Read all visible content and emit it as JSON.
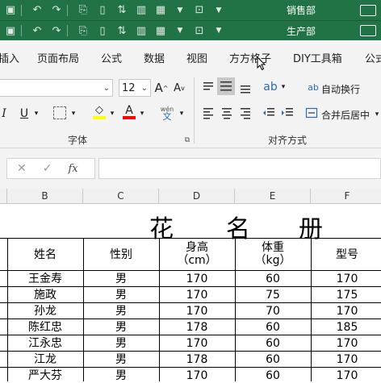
{
  "quick_access": [
    {
      "department": "销售部"
    },
    {
      "department": "生产部"
    }
  ],
  "ribbon_tabs": [
    "插入",
    "页面布局",
    "公式",
    "数据",
    "视图",
    "方方格子",
    "DIY工具箱",
    "公式"
  ],
  "font_group": {
    "label": "字体",
    "font_name": "",
    "font_size": "12",
    "underline": "U"
  },
  "align_group": {
    "label": "对齐方式",
    "wrap_text": "自动换行",
    "merge_center": "合并后居中"
  },
  "formula_bar": {
    "fx_label": "fx",
    "content": ""
  },
  "columns": [
    "B",
    "C",
    "D",
    "E",
    "F"
  ],
  "sheet_title": [
    "花",
    "名",
    "册"
  ],
  "table": {
    "headers": [
      {
        "line1": "姓名",
        "line2": ""
      },
      {
        "line1": "性别",
        "line2": ""
      },
      {
        "line1": "身高",
        "line2": "（cm）"
      },
      {
        "line1": "体重",
        "line2": "（kg）"
      },
      {
        "line1": "型号",
        "line2": ""
      }
    ],
    "rows": [
      [
        "王金寿",
        "男",
        "170",
        "60",
        "170"
      ],
      [
        "施政",
        "男",
        "170",
        "75",
        "175"
      ],
      [
        "孙龙",
        "男",
        "170",
        "70",
        "170"
      ],
      [
        "陈红忠",
        "男",
        "178",
        "60",
        "185"
      ],
      [
        "江永忠",
        "男",
        "170",
        "60",
        "170"
      ],
      [
        "江龙",
        "男",
        "178",
        "60",
        "170"
      ],
      [
        "严大芬",
        "男",
        "170",
        "60",
        "170"
      ]
    ]
  },
  "colors": {
    "title_bar": "#217346",
    "ribbon_bg": "#f3f3f3",
    "fill_color": "#ffff00",
    "font_color": "#ff0000"
  }
}
